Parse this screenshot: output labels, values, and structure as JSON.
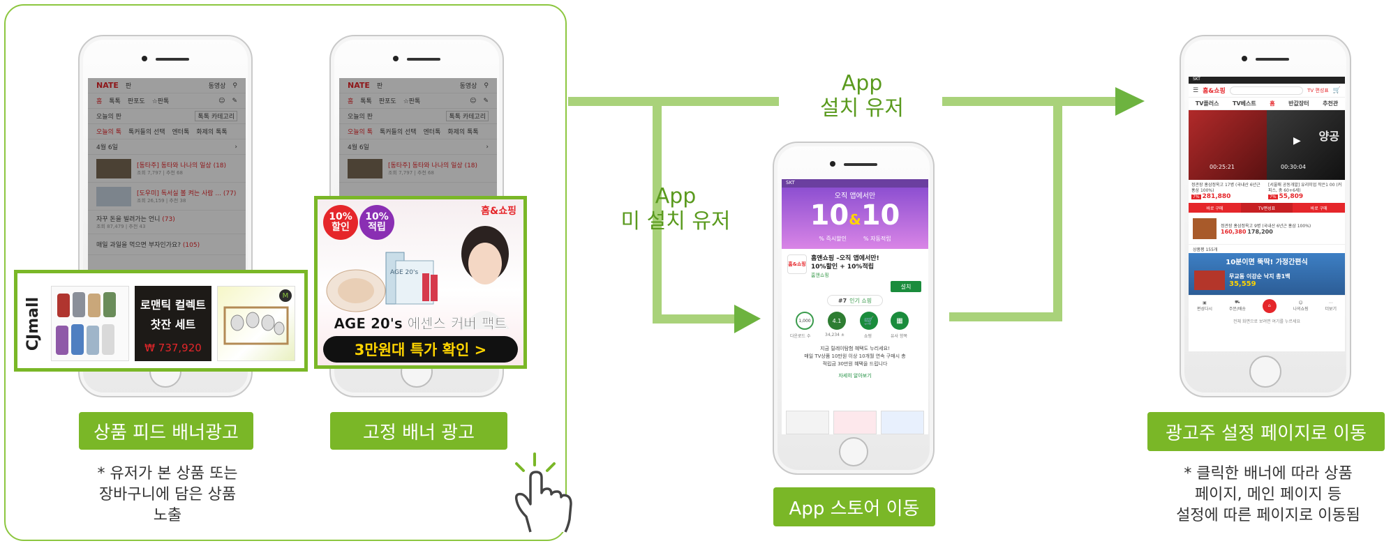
{
  "labels": {
    "feed_banner_button": "상품 피드 배너광고",
    "fixed_banner_button": "고정 배너 광고",
    "feed_note_line1": "* 유저가 본 상품 또는",
    "feed_note_line2": "장바구니에 담은 상품",
    "feed_note_line3": "노출",
    "app_installed_line1": "App",
    "app_installed_line2": "설치 유저",
    "app_not_installed_line1": "App",
    "app_not_installed_line2": "미 설치 유저",
    "app_store_button": "App 스토어 이동",
    "advertiser_page_button": "광고주 설정 페이지로 이동",
    "advertiser_note_line1": "* 클릭한 배너에 따라 상품",
    "advertiser_note_line2": "페이지, 메인 페이지 등",
    "advertiser_note_line3": "설정에 따른 페이지로 이동됨"
  },
  "nate_screen": {
    "logo": "NATE",
    "logo_sub": "판",
    "header_right": "동영상",
    "tabs": [
      "홈",
      "톡톡",
      "판포도",
      "☆판톡"
    ],
    "section_title": "오늘의 판",
    "section_button": "톡톡 카테고리",
    "subtabs": [
      "오늘의 톡",
      "톡커들의 선택",
      "엔터톡",
      "화제의 톡톡"
    ],
    "date": "4월 6일",
    "feed": [
      {
        "title": "[동타주] 동타와 나나의 일상",
        "count": "(18)",
        "meta": "조회 7,797 | 추천 68"
      },
      {
        "title": "[도우미] 독서실 볼 켜는 사람 ...",
        "count": "(77)",
        "meta": "조회 26,159 | 추천 38"
      },
      {
        "title": "자꾸 돈을 빌려가는 언니",
        "count": "(73)",
        "meta": "조회 87,479 | 추천 43"
      },
      {
        "title": "매일 과일을 먹으면 부자인가요?",
        "count": "(105)",
        "meta": ""
      }
    ]
  },
  "feed_banner": {
    "brand": "CJmall",
    "product_text_line1": "로맨틱 컬렉트",
    "product_text_line2": "찻잔 세트",
    "price": "₩ 737,920",
    "badge": "M"
  },
  "fixed_banner": {
    "badge1_line1": "10%",
    "badge1_line2": "할인",
    "badge2_line1": "10%",
    "badge2_line2": "적립",
    "brand": "홈&쇼핑",
    "product_label": "AGE 20's",
    "headline": "AGE 20's 에센스 커버 팩트",
    "cta": "3만원대 특가 확인 >"
  },
  "store_screen": {
    "status": "SKT",
    "banner_top": "오직 앱에서만",
    "big_left": "10",
    "big_amp": "&",
    "big_right": "10",
    "sub_left": "% 즉시할인",
    "sub_right": "% 자동적립",
    "app_icon_text": "홈&쇼핑",
    "app_title_line1": "홈앤쇼핑 –오직 앱에서만!",
    "app_title_line2": "10%할인 + 10%적립",
    "app_developer": "홈앤쇼핑",
    "install_button": "설치",
    "rank": "#7",
    "rank_label": "인기 쇼핑",
    "stats": [
      {
        "value": "1,000",
        "label": "다운로드 수"
      },
      {
        "value": "4.1",
        "label": "34,234 ±"
      },
      {
        "value": "",
        "label": "쇼핑"
      },
      {
        "value": "",
        "label": "유사 항목"
      }
    ],
    "desc_line1": "지금 릴레이탐험 혜택도 누리세요!",
    "desc_line2": "매일 TV상품 10만원 이상 10개월 연속 구매시 총",
    "desc_line3": "적립금 30만원 혜택을 드립니다",
    "more_link": "자세히 알아보기"
  },
  "shop_screen": {
    "status": "SKT",
    "logo": "홈&쇼핑",
    "tv_label": "TV 편성표",
    "tabs": [
      "TV플러스",
      "TV베스트",
      "홈",
      "반값장터",
      "추천관"
    ],
    "video_time1": "00:25:21",
    "video_time2": "00:30:04",
    "video_text": "양공",
    "product1": "정관장 홍삼정옥고 17병 (국내산 6년근 홍삼 100%)",
    "product1_discount": "7%",
    "product1_price": "281,880",
    "product2": "[서울매 공동개발] 유리미업 작은1 00 (커피스, 총 60+6세)",
    "product2_discount": "7%",
    "product2_price": "55,809",
    "buy_button": "바로 구매",
    "tv_schedule": "TV편성표",
    "product3": "정관장 홍삼정옥고 9병 (국내산 6년근 홍삼 100%)",
    "product3_price1": "160,380",
    "product3_price2": "178,200",
    "count_label": "상품평 155개",
    "promo_title": "10분이면 뚝딱! 가정간편식",
    "promo_item": "무교동 이강순 낙지 총1백",
    "promo_price": "35,559",
    "nav": [
      "편성다시",
      "주문/배송",
      "",
      "나의쇼핑",
      "더보기"
    ],
    "footer": "전체 화면으로 보려면 여기를 누르세요"
  },
  "colors": {
    "green": "#7ab727",
    "frame_green": "#8cc63f",
    "arrow_green": "#8cc63f",
    "arrow_head": "#6db33f",
    "red": "#e5262a",
    "label_green": "#5a9a1e"
  }
}
